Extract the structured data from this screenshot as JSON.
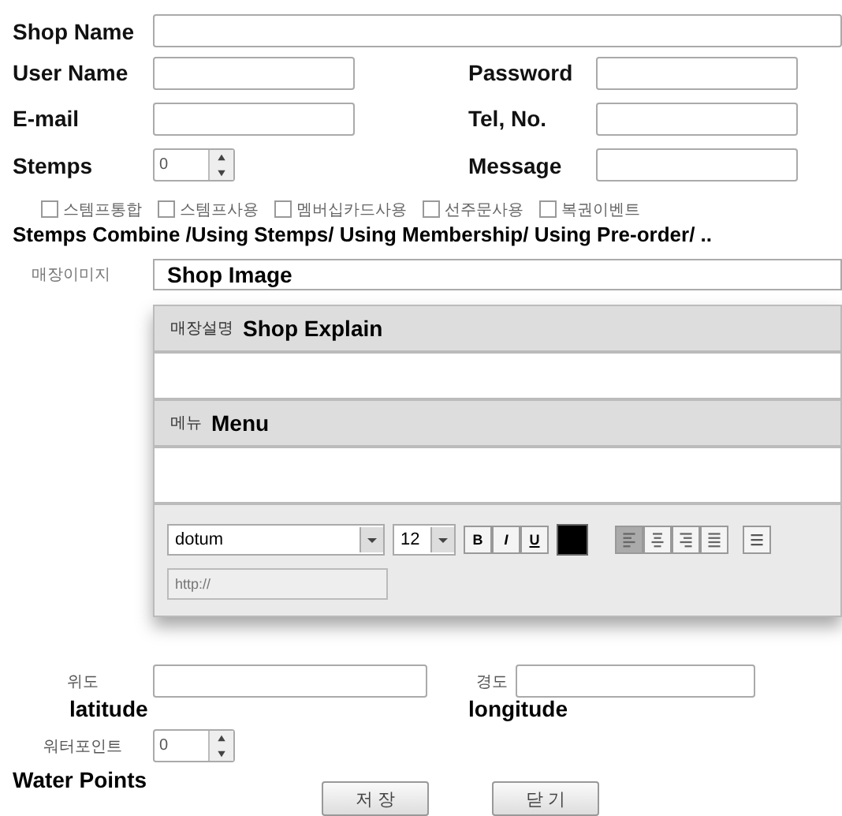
{
  "shop_name": {
    "label": "Shop Name"
  },
  "fields": [
    {
      "label": "User Name"
    },
    {
      "label": "Password"
    },
    {
      "label": "E-mail"
    },
    {
      "label": "Tel, No."
    },
    {
      "label": "Stemps",
      "kind": "spinner",
      "value": "0"
    },
    {
      "label": "Message"
    }
  ],
  "options": [
    {
      "label": "스템프통합",
      "checked": false
    },
    {
      "label": "스템프사용",
      "checked": false
    },
    {
      "label": "멤버십카드사용",
      "checked": false
    },
    {
      "label": "선주문사용",
      "checked": false
    },
    {
      "label": "복권이벤트",
      "checked": false
    }
  ],
  "options_caption": "Stemps Combine /Using Stemps/ Using Membership/ Using Pre-order/ ..",
  "shop_image": {
    "label": "매장이미지",
    "value": "Shop Image"
  },
  "explain": {
    "label_ko": "매장설명",
    "label": "Shop Explain"
  },
  "menu": {
    "label_ko": "메뉴",
    "label": "Menu"
  },
  "toolbar": {
    "font": "dotum",
    "size": "12",
    "styles": [
      "B",
      "I",
      "U"
    ],
    "color": "#000000",
    "alignments": [
      {
        "kind": "left",
        "selected": true
      },
      {
        "kind": "center",
        "selected": false
      },
      {
        "kind": "right",
        "selected": false
      },
      {
        "kind": "justify",
        "selected": false
      }
    ],
    "link_placeholder": "http://"
  },
  "coords": [
    {
      "label_ko": "위도",
      "label": "latitude"
    },
    {
      "label_ko": "경도",
      "label": "longitude"
    }
  ],
  "water_points": {
    "label_ko": "워터포인트",
    "label": "Water Points",
    "value": "0"
  },
  "buttons": [
    "저 장",
    "닫 기"
  ]
}
